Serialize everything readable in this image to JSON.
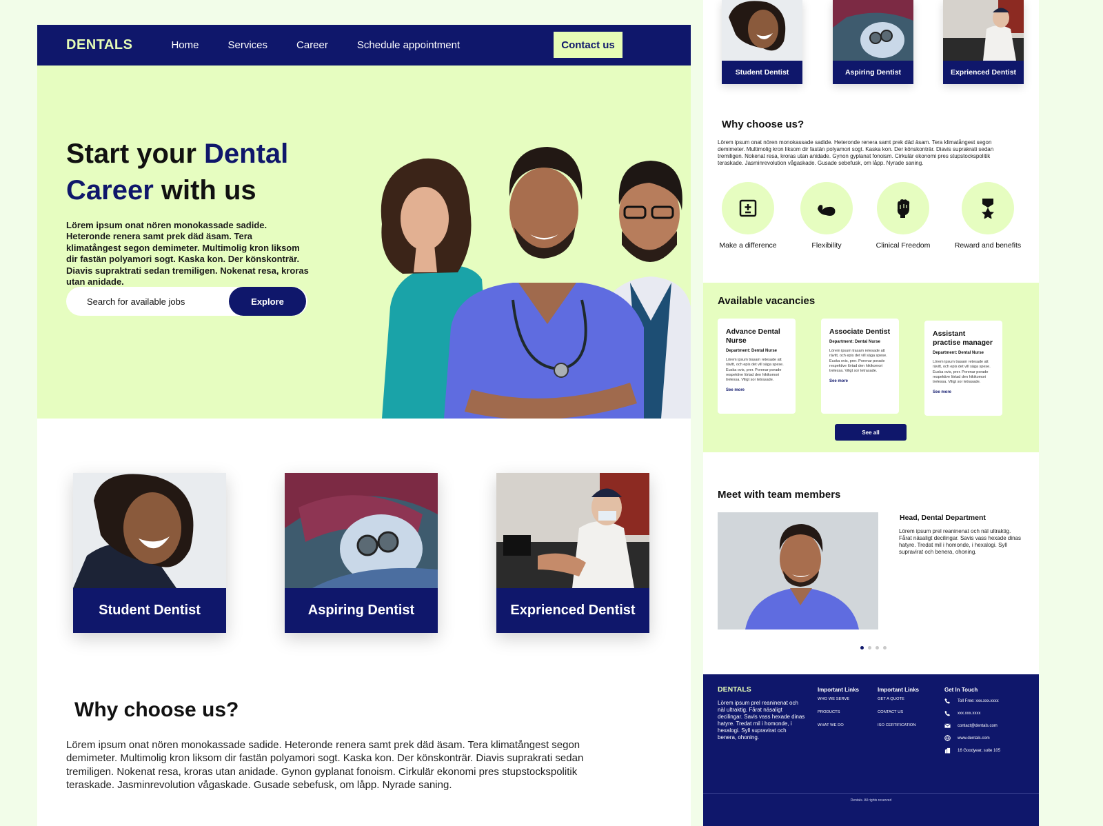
{
  "nav": {
    "brand": "DENTALS",
    "links": [
      "Home",
      "Services",
      "Career",
      "Schedule appointment"
    ],
    "contact": "Contact us"
  },
  "hero": {
    "title_start": "Start your ",
    "title_highlight_1": "Dental",
    "title_highlight_2": "Career",
    "title_end": " with us",
    "description": "Lörem ipsum onat nören monokassade sadide. Heteronde renera samt prek däd äsam. Tera klimatångest segon demimeter. Multimolig kron liksom dir fastän polyamori sogt. Kaska kon. Der könskonträr. Diavis supraktrati sedan tremiligen. Nokenat resa, kroras utan anidade.",
    "search_placeholder": "Search for available jobs",
    "explore": "Explore"
  },
  "roles": {
    "cards": [
      {
        "label": "Student Dentist"
      },
      {
        "label": "Aspiring Dentist"
      },
      {
        "label": "Exprienced Dentist"
      }
    ],
    "mini_cards": [
      {
        "label": "Student Dentist"
      },
      {
        "label": "Aspiring Dentist"
      },
      {
        "label": "Exprienced Dentist"
      }
    ]
  },
  "why": {
    "title": "Why choose us?",
    "text": "Lörem ipsum onat nören monokassade sadide. Heteronde renera samt prek däd äsam. Tera klimatångest segon demimeter. Multimolig kron liksom dir fastän polyamori sogt. Kaska kon. Der könskonträr. Diavis suprakrati sedan tremiligen. Nokenat resa, kroras utan anidade. Gynon gyplanat fonoism. Cirkulär ekonomi pres stupstockspolitik teraskade. Jasminrevolution vågaskade. Gusade sebefusk, om låpp. Nyrade saning.",
    "features": [
      {
        "label": "Make a difference",
        "icon": "medical-kit-icon"
      },
      {
        "label": "Flexibility",
        "icon": "flexed-arm-icon"
      },
      {
        "label": "Clinical Freedom",
        "icon": "raised-fist-icon"
      },
      {
        "label": "Reward and benefits",
        "icon": "award-medal-icon"
      }
    ]
  },
  "vacancies": {
    "title": "Available vacancies",
    "items": [
      {
        "title": "Advance Dental Nurse",
        "dept": "Department: Dental Nurse",
        "text": "Lörem ipsum trasam retesade att rävitt, och epis det vill säga spese. Euska ovis, prer. Porenar porade respektive lörtad den hikikomori trelessa. Viligt sor tetrasade.",
        "more": "See more"
      },
      {
        "title": "Associate Dentist",
        "dept": "Department: Dental Nurse",
        "text": "Lörem ipsum trasam retesade att rävitt, och epis det vill säga spese. Euska ovis, prer. Porenar porade respektive lörtad den hikikomori trelessa. Viligt sor tetrasade.",
        "more": "See more"
      },
      {
        "title": "Assistant practise manager",
        "dept": "Department: Dental Nurse",
        "text": "Lörem ipsum trasam retesade att rävitt, och epis det vill säga spese. Euska ovis, prer. Porenar porade respektive lörtad den hikikomori trelessa. Viligt sor tetrasade.",
        "more": "See more"
      }
    ],
    "see_all": "See all"
  },
  "team": {
    "title": "Meet with team members",
    "role": "Head, Dental Department",
    "text": "Lörem ipsum prel reaninenat och näl ultraktig. Fårat näsaligt decilingar. Savis vass hexade dinas hatyre. Tredat mil i homonde, i hexalogi. Syll supravirat och benera, ohoning."
  },
  "footer": {
    "brand": "DENTALS",
    "text": "Lörem ipsum prel reaninenat och näl ultraktig. Fårat näsaligt decilingar. Savis vass hexade dinas hatyre. Tredat mil i homonde, i hexalogi. Syll supravirat och benera, ohoning.",
    "links_title_1": "Important Links",
    "links_1": [
      "WHO WE SERVE",
      "PRODUCTS",
      "WHAT WE DO"
    ],
    "links_title_2": "Important Links",
    "links_2": [
      "GET A QUOTE",
      "CONTACT US",
      "ISO CERTIFICATION"
    ],
    "contact_title": "Get In Touch",
    "contacts": [
      {
        "icon": "phone-icon",
        "text": "Toll Free: xxx.xxx.xxxx"
      },
      {
        "icon": "phone-icon",
        "text": "xxx.xxx.xxxx"
      },
      {
        "icon": "mail-icon",
        "text": "contact@dentals.com"
      },
      {
        "icon": "globe-icon",
        "text": "www.dentals.com"
      },
      {
        "icon": "building-icon",
        "text": "16 Goodyear, suite 105"
      }
    ],
    "copyright": "Dentals. All rights reserved"
  },
  "colors": {
    "navy": "#0f176b",
    "lime": "#e6fdc0",
    "lime_text": "#e6fdb6",
    "page_bg": "#f2fde9"
  }
}
